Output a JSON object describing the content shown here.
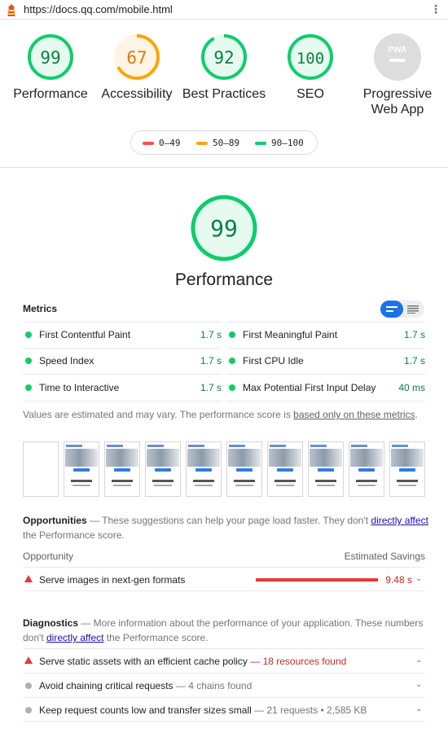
{
  "browser": {
    "url": "https://docs.qq.com/mobile.html"
  },
  "categories": [
    {
      "label": "Performance",
      "score": 99,
      "level": "pass"
    },
    {
      "label": "Accessibility",
      "score": 67,
      "level": "average"
    },
    {
      "label": "Best Practices",
      "score": 92,
      "level": "pass"
    },
    {
      "label": "SEO",
      "score": 100,
      "level": "pass"
    },
    {
      "label_line1": "Progressive",
      "label_line2": "Web App",
      "badge": "PWA"
    }
  ],
  "legend": {
    "fail": "0–49",
    "average": "50–89",
    "pass": "90–100"
  },
  "colors": {
    "pass": "#0cce6b",
    "average": "#ffa400",
    "fail": "#ff4e42",
    "pwa": "#bdbdbd"
  },
  "performance": {
    "score": 99,
    "title": "Performance"
  },
  "metrics": {
    "heading": "Metrics",
    "items": [
      {
        "label": "First Contentful Paint",
        "value": "1.7 s"
      },
      {
        "label": "First Meaningful Paint",
        "value": "1.7 s"
      },
      {
        "label": "Speed Index",
        "value": "1.7 s"
      },
      {
        "label": "First CPU Idle",
        "value": "1.7 s"
      },
      {
        "label": "Time to Interactive",
        "value": "1.7 s"
      },
      {
        "label": "Max Potential First Input Delay",
        "value": "40 ms"
      }
    ],
    "note_prefix": "Values are estimated and may vary. The performance score is ",
    "note_link": "based only on these metrics",
    "note_suffix": "."
  },
  "opportunities": {
    "title": "Opportunities",
    "desc_prefix": " — These suggestions can help your page load faster. They don't ",
    "desc_link": "directly affect",
    "desc_suffix": " the Performance score.",
    "col_left": "Opportunity",
    "col_right": "Estimated Savings",
    "items": [
      {
        "label": "Serve images in next-gen formats",
        "savings": "9.48 s"
      }
    ]
  },
  "diagnostics": {
    "title": "Diagnostics",
    "desc_prefix": " — More information about the performance of your application. These numbers don't ",
    "desc_link": "directly affect",
    "desc_suffix": " the Performance score.",
    "items": [
      {
        "label": "Serve static assets with an efficient cache policy",
        "detail": " — 18 resources found",
        "level": "fail"
      },
      {
        "label": "Avoid chaining critical requests",
        "detail": " — 4 chains found",
        "level": "info"
      },
      {
        "label": "Keep request counts low and transfer sizes small",
        "detail": " — 21 requests • 2,585 KB",
        "level": "info"
      }
    ]
  }
}
